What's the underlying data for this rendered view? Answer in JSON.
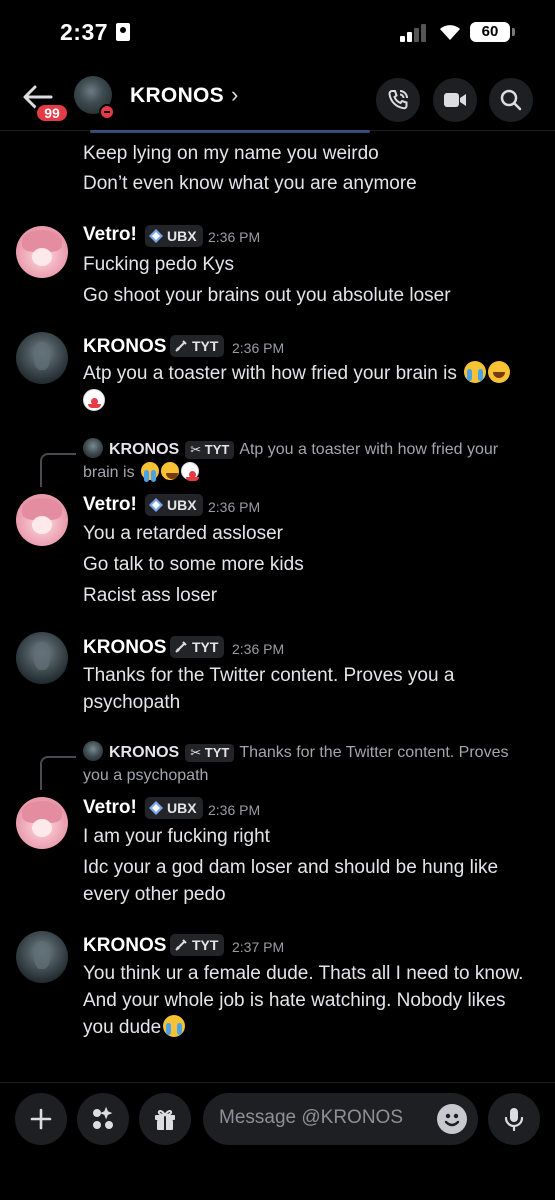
{
  "status_bar": {
    "time": "2:37",
    "battery": "60"
  },
  "header": {
    "unread_count": "99",
    "name": "KRONOS",
    "chevron": "›"
  },
  "messages": {
    "partial": {
      "lines": [
        "Keep lying on my name you weirdo",
        "Don’t even know what you are anymore"
      ]
    },
    "m1": {
      "author": "Vetro!",
      "tag": "UBX",
      "time": "2:36 PM",
      "lines": [
        "Fucking pedo Kys",
        "Go shoot your brains out you absolute loser"
      ]
    },
    "m2": {
      "author": "KRONOS",
      "tag": "TYT",
      "time": "2:36 PM",
      "line1": "Atp you a toaster with how fried your brain is"
    },
    "m3": {
      "reply_author": "KRONOS",
      "reply_tag": "TYT",
      "reply_text_1": "Atp you a toaster with how fried your",
      "reply_text_2": "brain is",
      "author": "Vetro!",
      "tag": "UBX",
      "time": "2:36 PM",
      "lines": [
        "You a retarded assloser",
        "Go talk to some more kids",
        "Racist ass loser"
      ]
    },
    "m4": {
      "author": "KRONOS",
      "tag": "TYT",
      "time": "2:36 PM",
      "lines": [
        "Thanks for the Twitter content. Proves you a",
        "psychopath"
      ]
    },
    "m5": {
      "reply_author": "KRONOS",
      "reply_tag": "TYT",
      "reply_text_1": "Thanks for the Twitter content. Proves",
      "reply_text_2": "you a psychopath",
      "author": "Vetro!",
      "tag": "UBX",
      "time": "2:36 PM",
      "lines": [
        "I am your fucking right",
        "Idc your a god dam loser and should be hung like",
        "every other pedo"
      ]
    },
    "m6": {
      "author": "KRONOS",
      "tag": "TYT",
      "time": "2:37 PM",
      "lines": [
        "You think ur a female dude. Thats all I need to know.",
        "And your whole job is hate watching. Nobody likes",
        "you dude"
      ]
    }
  },
  "composer": {
    "placeholder": "Message @KRONOS"
  },
  "icons": {
    "back": "arrow-left-icon",
    "call": "phone-call-icon",
    "video": "video-camera-icon",
    "search": "search-icon",
    "plus": "plus-icon",
    "apps": "apps-icon",
    "gift": "gift-icon",
    "emoji": "emoji-icon",
    "mic": "microphone-icon"
  },
  "colors": {
    "background": "#000000",
    "badge": "#e43b44",
    "surface": "#1e1f22",
    "tag_bg": "#232428"
  }
}
